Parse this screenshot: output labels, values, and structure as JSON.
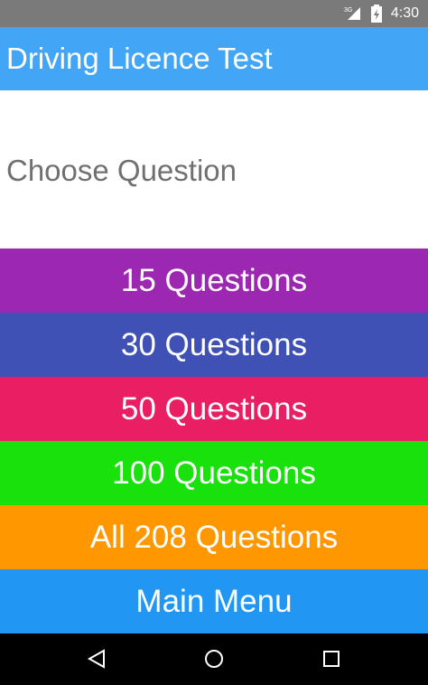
{
  "status_bar": {
    "network": "3G",
    "time": "4:30",
    "icons": [
      "signal-icon",
      "battery-icon"
    ]
  },
  "app_bar": {
    "title": "Driving Licence Test"
  },
  "main": {
    "heading": "Choose Question",
    "buttons": [
      {
        "label": "15 Questions",
        "color": "#9c27b0"
      },
      {
        "label": "30 Questions",
        "color": "#3f51b5"
      },
      {
        "label": "50 Questions",
        "color": "#e91e63"
      },
      {
        "label": "100 Questions",
        "color": "#18e10b"
      },
      {
        "label": "All 208 Questions",
        "color": "#ff9800"
      },
      {
        "label": "Main Menu",
        "color": "#2196f3"
      }
    ]
  },
  "nav_bar": {
    "icons": [
      "back-icon",
      "home-icon",
      "recents-icon"
    ]
  }
}
